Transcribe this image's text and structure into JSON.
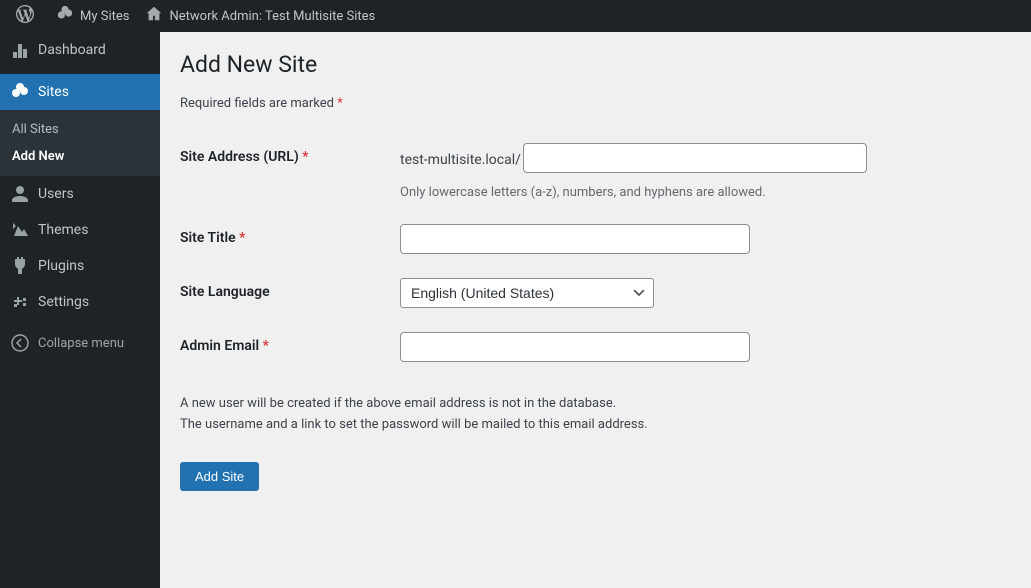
{
  "adminbar": {
    "my_sites": "My Sites",
    "network_admin": "Network Admin: Test Multisite Sites"
  },
  "menu": {
    "dashboard": "Dashboard",
    "sites": "Sites",
    "sites_sub": {
      "all": "All Sites",
      "add": "Add New"
    },
    "users": "Users",
    "themes": "Themes",
    "plugins": "Plugins",
    "settings": "Settings",
    "collapse": "Collapse menu"
  },
  "page": {
    "title": "Add New Site",
    "required_note": "Required fields are marked ",
    "labels": {
      "address": "Site Address (URL) ",
      "title": "Site Title ",
      "language": "Site Language",
      "admin_email": "Admin Email "
    },
    "address_prefix": "test-multisite.local/",
    "address_desc": "Only lowercase letters (a-z), numbers, and hyphens are allowed.",
    "language_value": "English (United States)",
    "note1": "A new user will be created if the above email address is not in the database.",
    "note2": "The username and a link to set the password will be mailed to this email address.",
    "submit": "Add Site"
  }
}
